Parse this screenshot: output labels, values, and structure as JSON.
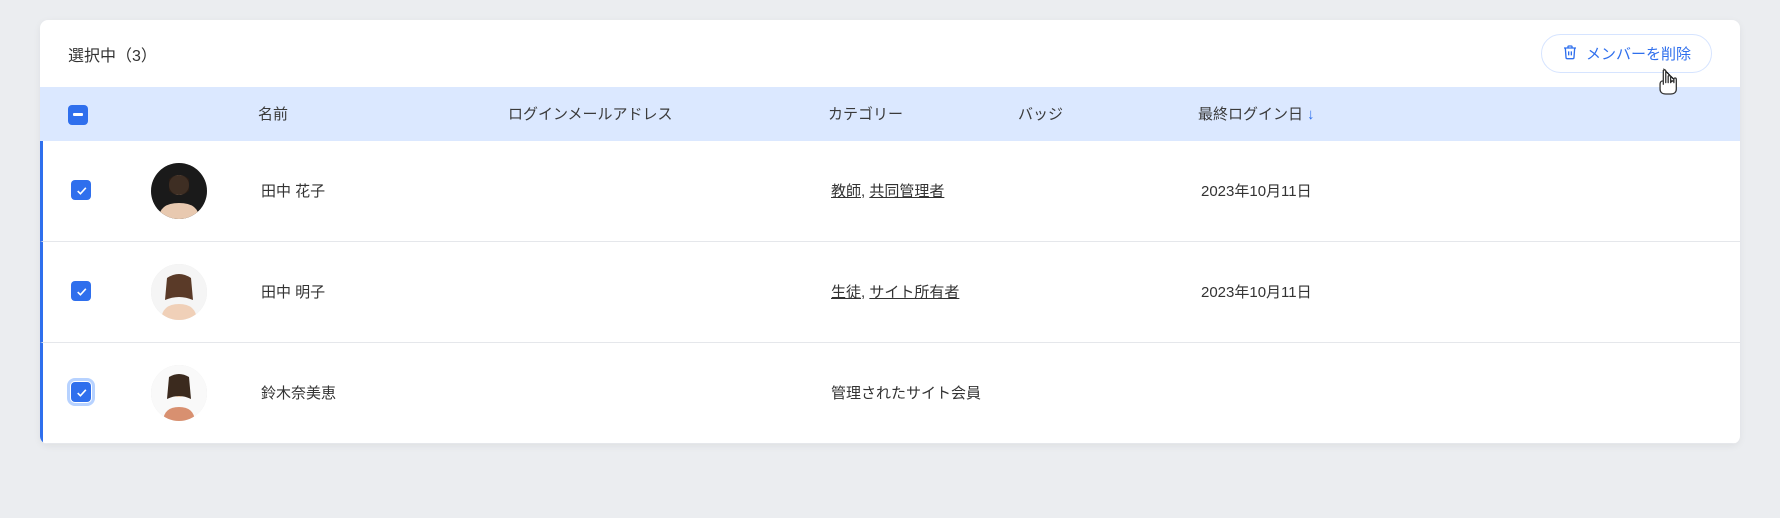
{
  "toolbar": {
    "selection_label": "選択中（3）",
    "delete_label": "メンバーを削除"
  },
  "columns": {
    "name": "名前",
    "email": "ログインメールアドレス",
    "category": "カテゴリー",
    "badge": "バッジ",
    "last_login": "最終ログイン日"
  },
  "rows": [
    {
      "name": "田中 花子",
      "categories": [
        "教師",
        "共同管理者"
      ],
      "category_links": [
        true,
        true
      ],
      "last_login": "2023年10月11日",
      "checked": true,
      "focused": false
    },
    {
      "name": "田中 明子",
      "categories": [
        "生徒",
        "サイト所有者"
      ],
      "category_links": [
        true,
        true
      ],
      "last_login": "2023年10月11日",
      "checked": true,
      "focused": false
    },
    {
      "name": "鈴木奈美恵",
      "categories": [
        "管理されたサイト会員"
      ],
      "category_links": [
        false
      ],
      "last_login": "",
      "checked": true,
      "focused": true
    }
  ]
}
